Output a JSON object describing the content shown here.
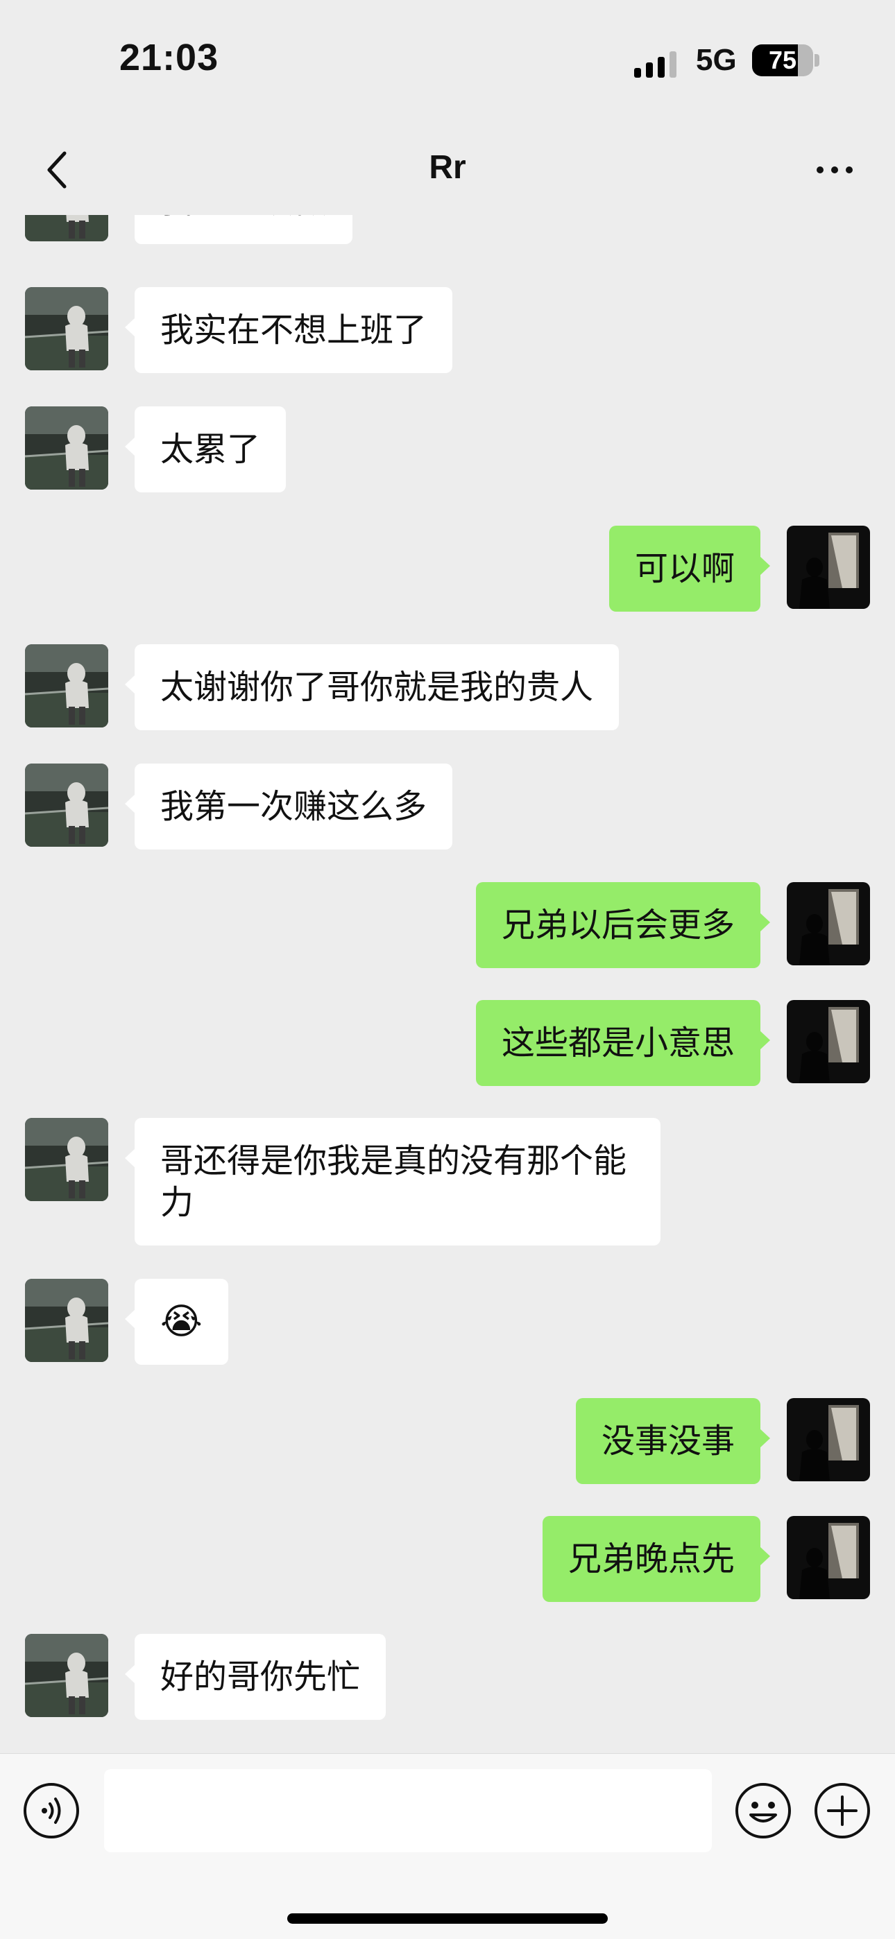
{
  "status_bar": {
    "time": "21:03",
    "network": "5G",
    "battery": "75",
    "battery_level": 0.75,
    "signal_bars_filled": 3
  },
  "nav": {
    "title": "Rr",
    "back_icon": "chevron-left-icon",
    "more_icon": "more-dots-icon"
  },
  "messages": [
    {
      "side": "left",
      "text": "我想继续做"
    },
    {
      "side": "left",
      "text": "我实在不想上班了"
    },
    {
      "side": "left",
      "text": "太累了"
    },
    {
      "side": "right",
      "text": "可以啊"
    },
    {
      "side": "left",
      "text": "太谢谢你了哥你就是我的贵人"
    },
    {
      "side": "left",
      "text": "我第一次赚这么多"
    },
    {
      "side": "right",
      "text": "兄弟以后会更多"
    },
    {
      "side": "right",
      "text": "这些都是小意思"
    },
    {
      "side": "left",
      "text": "哥还得是你我是真的没有那个能力"
    },
    {
      "side": "left",
      "text": "😭"
    },
    {
      "side": "right",
      "text": "没事没事"
    },
    {
      "side": "right",
      "text": "兄弟晚点先"
    },
    {
      "side": "left",
      "text": "好的哥你先忙"
    }
  ],
  "input_bar": {
    "voice_icon": "voice-icon",
    "emoji_icon": "emoji-icon",
    "plus_icon": "plus-icon",
    "input_value": ""
  },
  "colors": {
    "background": "#ededed",
    "sent_bubble": "#95ec69",
    "received_bubble": "#ffffff"
  }
}
